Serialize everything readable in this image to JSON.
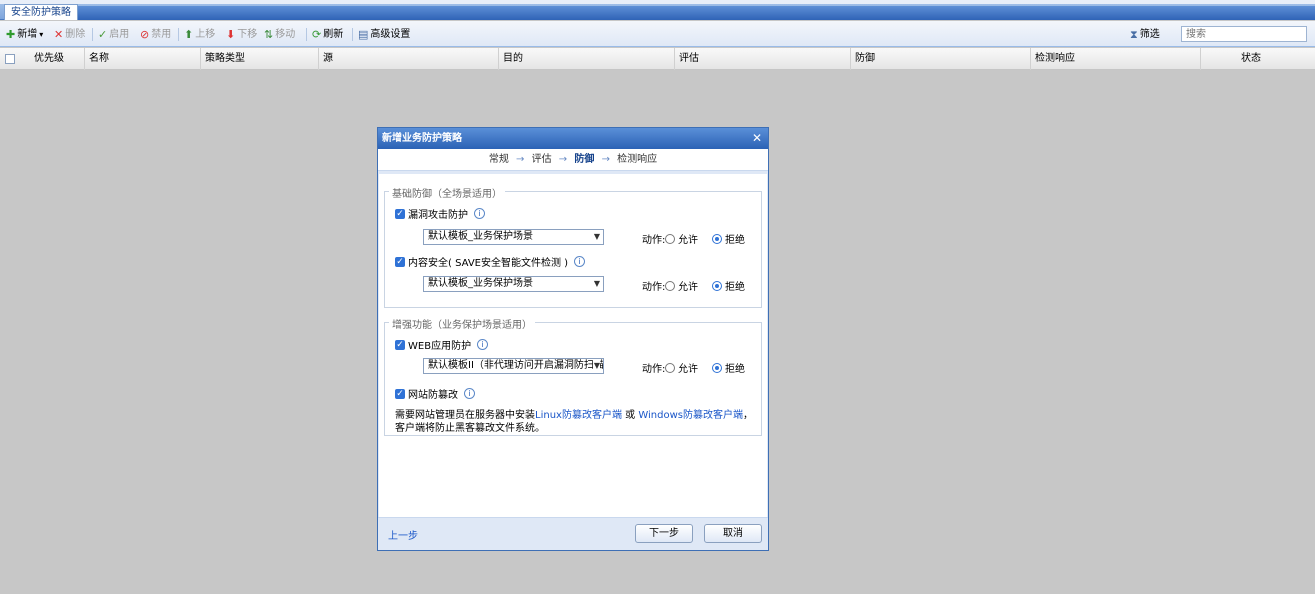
{
  "tabs": [
    {
      "label": "安全防护策略"
    }
  ],
  "toolbar": {
    "add": "新增",
    "delete": "删除",
    "enable": "启用",
    "disable": "禁用",
    "move_up": "上移",
    "move_down": "下移",
    "move": "移动",
    "refresh": "刷新",
    "advanced": "高级设置",
    "filter": "筛选",
    "search_placeholder": "搜索"
  },
  "grid": {
    "columns": [
      "优先级",
      "名称",
      "策略类型",
      "源",
      "目的",
      "评估",
      "防御",
      "检测响应",
      "状态"
    ]
  },
  "dialog": {
    "title": "新增业务防护策略",
    "steps": [
      "常规",
      "评估",
      "防御",
      "检测响应"
    ],
    "current_step": "防御",
    "basic": {
      "legend": "基础防御（全场景适用）",
      "vuln": {
        "label": "漏洞攻击防护",
        "checked": true,
        "template": "默认模板_业务保护场景",
        "action_label": "动作:",
        "allow": "允许",
        "deny": "拒绝",
        "selected": "拒绝"
      },
      "content": {
        "label": "内容安全( SAVE安全智能文件检测 )",
        "checked": true,
        "template": "默认模板_业务保护场景",
        "action_label": "动作:",
        "allow": "允许",
        "deny": "拒绝",
        "selected": "拒绝"
      }
    },
    "enhanced": {
      "legend": "增强功能（业务保护场景适用）",
      "waf": {
        "label": "WEB应用防护",
        "checked": true,
        "template": "默认模板II（非代理访问开启漏洞防扫描",
        "action_label": "动作:",
        "allow": "允许",
        "deny": "拒绝",
        "selected": "拒绝"
      },
      "tamper": {
        "label": "网站防篡改",
        "checked": true,
        "desc_prefix": "需要网站管理员在服务器中安装",
        "linux_link": "Linux防篡改客户端",
        "desc_or": " 或 ",
        "windows_link": "Windows防篡改客户端",
        "desc_suffix": "，客户端将防止黑客篡改文件系统。"
      }
    },
    "footer": {
      "prev": "上一步",
      "next": "下一步",
      "cancel": "取消"
    }
  }
}
